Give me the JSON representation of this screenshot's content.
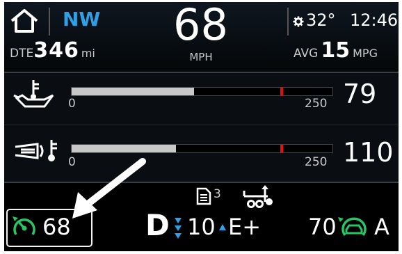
{
  "header": {
    "home_icon": "home-icon",
    "compass": "NW",
    "speed": "68",
    "speed_unit": "MPH",
    "gear_icon": "gear-icon",
    "outside_temp": "32°",
    "clock": "12:46",
    "dte_label": "DTE",
    "dte_value": "346",
    "dte_unit": "mi",
    "avg_label": "AVG",
    "avg_value": "15",
    "avg_unit": "MPG"
  },
  "gauges": [
    {
      "icon": "oil-temperature-icon",
      "min_label": "0",
      "max_label": "250",
      "reading": "79",
      "fill_fraction": 0.47,
      "redline_fraction": 0.8
    },
    {
      "icon": "transmission-temperature-icon",
      "min_label": "0",
      "max_label": "250",
      "reading": "110",
      "fill_fraction": 0.4,
      "redline_fraction": 0.8
    }
  ],
  "status_row": {
    "page_count": "3",
    "page_icon": "document-pages-icon",
    "trailer_icon": "trailer-hitch-icon"
  },
  "footer": {
    "cruise_icon": "cruise-control-icon",
    "cruise_speed": "68",
    "gear": "D",
    "gear_number": "10",
    "mode": "E+",
    "adaptive_icon": "adaptive-cruise-icon",
    "adaptive_speed": "70",
    "adaptive_suffix": "A"
  },
  "colors": {
    "accent_blue": "#2f9fe6",
    "cruise_green": "#29c463",
    "redline": "#e01010"
  }
}
